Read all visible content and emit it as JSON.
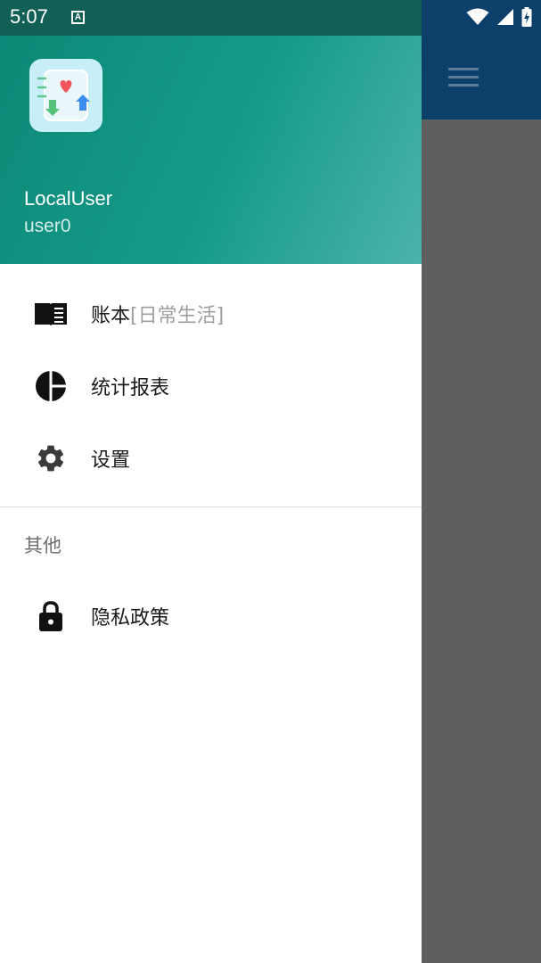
{
  "status_bar": {
    "time": "5:07",
    "notification_badge": "A"
  },
  "drawer": {
    "header": {
      "user_name": "LocalUser",
      "user_id": "user0"
    },
    "items": [
      {
        "label": "账本",
        "sub_label": "[日常生活]",
        "icon": "book-icon"
      },
      {
        "label": "统计报表",
        "icon": "pie-chart-icon"
      },
      {
        "label": "设置",
        "icon": "gear-icon"
      }
    ],
    "section_title": "其他",
    "other_items": [
      {
        "label": "隐私政策",
        "icon": "lock-icon"
      }
    ]
  },
  "colors": {
    "header_gradient_start": "#0e8877",
    "header_gradient_end": "#4cb3aa",
    "status_bar": "#126055",
    "background_appbar": "#0d3f6b",
    "scrim": "#5f5f5f"
  }
}
